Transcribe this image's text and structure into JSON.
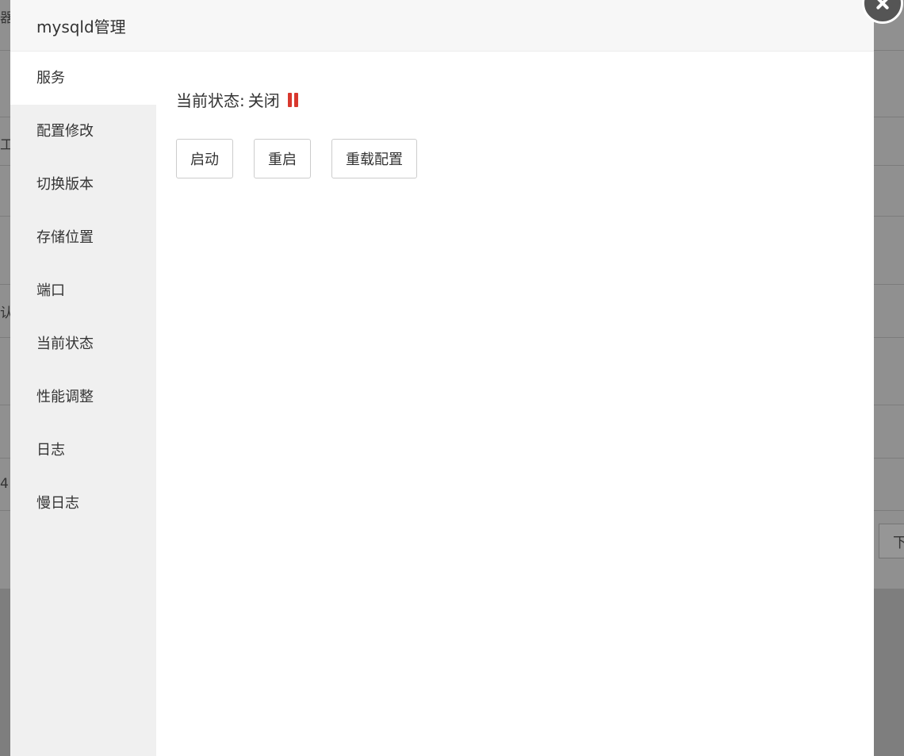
{
  "background": {
    "fragments": [
      "器",
      "工",
      "认",
      "4"
    ],
    "button_label": "下"
  },
  "modal": {
    "title": "mysqld管理",
    "close_icon": "close-icon"
  },
  "sidebar": {
    "items": [
      {
        "label": "服务",
        "active": true
      },
      {
        "label": "配置修改"
      },
      {
        "label": "切换版本"
      },
      {
        "label": "存储位置"
      },
      {
        "label": "端口"
      },
      {
        "label": "当前状态"
      },
      {
        "label": "性能调整"
      },
      {
        "label": "日志"
      },
      {
        "label": "慢日志"
      }
    ]
  },
  "service": {
    "status_label": "当前状态:",
    "status_value": "关闭",
    "status_icon": "pause-icon",
    "status_color": "#d8382e",
    "buttons": {
      "start": "启动",
      "restart": "重启",
      "reload": "重载配置"
    }
  }
}
